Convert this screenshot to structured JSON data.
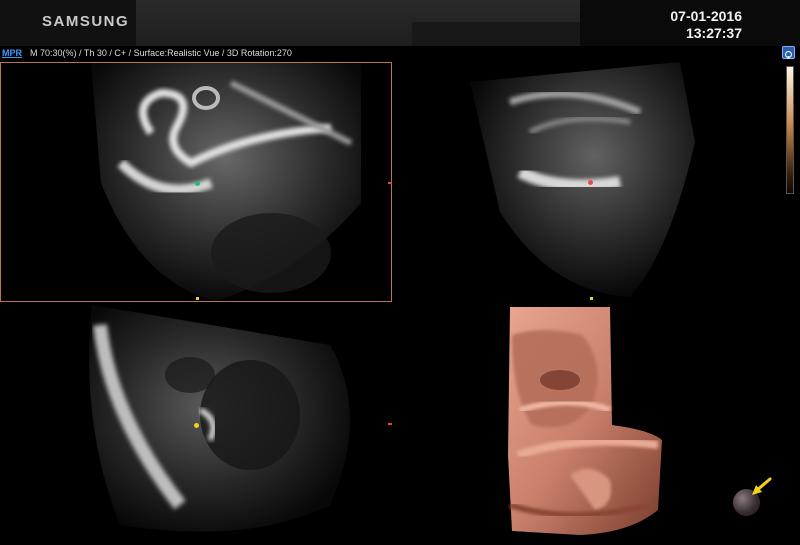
{
  "header": {
    "brand": "SAMSUNG",
    "date": "07-01-2016",
    "time": "13:27:37"
  },
  "status_line": {
    "mode_label": "MPR",
    "parameters": "M 70:30(%) / Th 30 / C+ / Surface:Realistic Vue / 3D Rotation:270"
  },
  "colors": {
    "accent_blue": "#3d9bff",
    "active_frame": "#b8784a",
    "marker_green": "#1fbf7a",
    "marker_red": "#e8494a",
    "marker_yellow": "#f0d020",
    "render_skin": "#c9806b"
  },
  "icons": {
    "settings": "settings-icon",
    "orientation": "orientation-ball-icon",
    "arrow": "yellow-arrow-icon"
  }
}
